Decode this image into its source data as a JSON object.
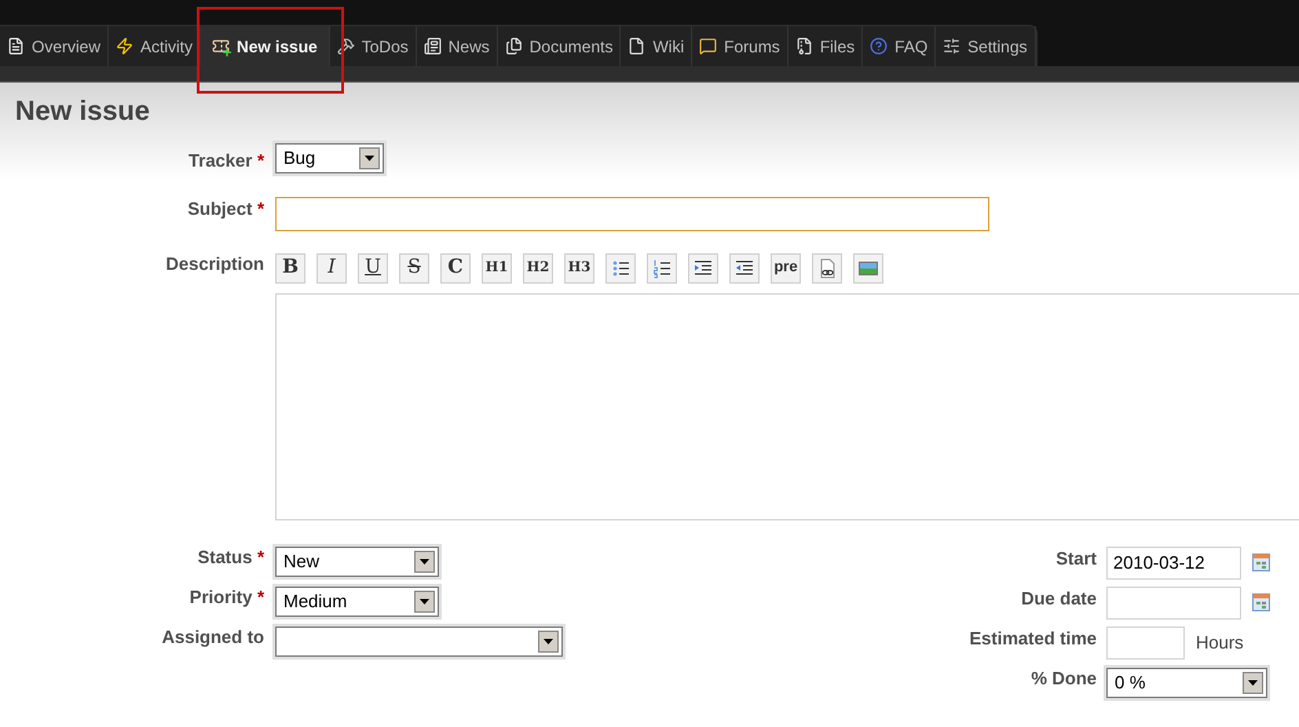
{
  "tabs": [
    {
      "label": "Overview",
      "selected": false
    },
    {
      "label": "Activity",
      "selected": false
    },
    {
      "label": "New issue",
      "selected": true
    },
    {
      "label": "ToDos",
      "selected": false
    },
    {
      "label": "News",
      "selected": false
    },
    {
      "label": "Documents",
      "selected": false
    },
    {
      "label": "Wiki",
      "selected": false
    },
    {
      "label": "Forums",
      "selected": false
    },
    {
      "label": "Files",
      "selected": false
    },
    {
      "label": "FAQ",
      "selected": false
    },
    {
      "label": "Settings",
      "selected": false
    }
  ],
  "page_title": "New issue",
  "tracker": {
    "label": "Tracker",
    "required": "*",
    "value": "Bug"
  },
  "subject": {
    "label": "Subject",
    "required": "*"
  },
  "description": {
    "label": "Description",
    "toolbar": [
      {
        "kind": "bold",
        "label": "B"
      },
      {
        "kind": "italic",
        "label": "I"
      },
      {
        "kind": "underline",
        "label": "U"
      },
      {
        "kind": "strike",
        "label": "S"
      },
      {
        "kind": "code",
        "label": "C"
      },
      {
        "kind": "heading",
        "label": "H1"
      },
      {
        "kind": "heading",
        "label": "H2"
      },
      {
        "kind": "heading",
        "label": "H3"
      },
      {
        "kind": "bullets"
      },
      {
        "kind": "numbers"
      },
      {
        "kind": "indent"
      },
      {
        "kind": "outdent"
      },
      {
        "kind": "pre",
        "label": "pre"
      },
      {
        "kind": "link"
      },
      {
        "kind": "image"
      }
    ]
  },
  "left_fields": [
    {
      "label": "Status",
      "required": "*",
      "value": "New"
    },
    {
      "label": "Priority",
      "required": "*",
      "value": "Medium"
    },
    {
      "label": "Assigned to"
    }
  ],
  "right_fields": [
    {
      "kind": "date",
      "label": "Start",
      "value": "2010-03-12"
    },
    {
      "kind": "date",
      "label": "Due date"
    },
    {
      "kind": "hours",
      "label": "Estimated time",
      "unit": "Hours"
    },
    {
      "kind": "select",
      "label": "% Done",
      "value": "0 %"
    }
  ]
}
